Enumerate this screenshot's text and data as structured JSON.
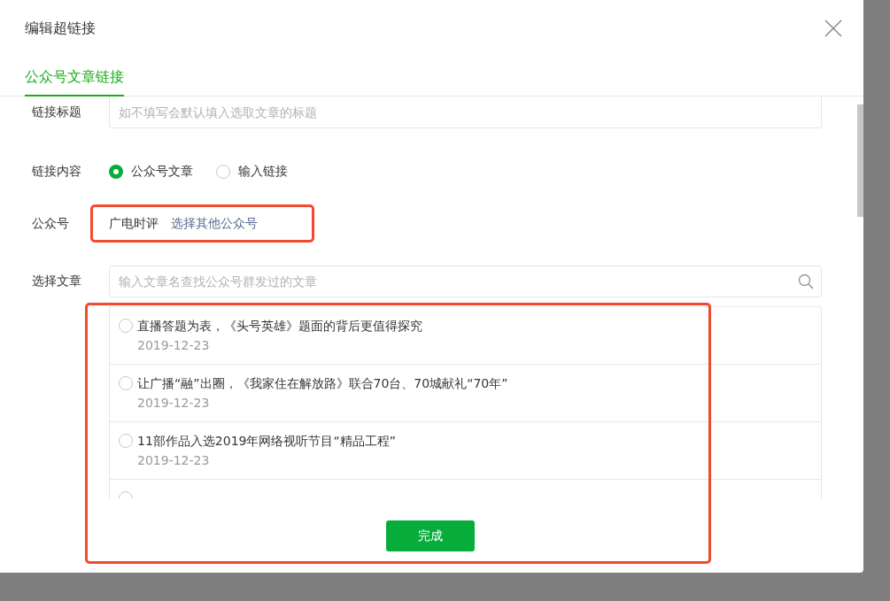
{
  "dialog": {
    "title": "编辑超链接"
  },
  "tabs": [
    {
      "label": "公众号文章链接",
      "selected": true
    }
  ],
  "link_title": {
    "label": "链接标题",
    "placeholder": "如不填写会默认填入选取文章的标题"
  },
  "link_content": {
    "label": "链接内容",
    "options": [
      {
        "label": "公众号文章",
        "selected": true
      },
      {
        "label": "输入链接",
        "selected": false
      }
    ]
  },
  "account": {
    "label": "公众号",
    "name": "广电时评",
    "change_link": "选择其他公众号",
    "highlighted": true
  },
  "article_search": {
    "label": "选择文章",
    "placeholder": "输入文章名查找公众号群发过的文章"
  },
  "articles": [
    {
      "title": "直播答题为表，《头号英雄》题面的背后更值得探究",
      "date": "2019-12-23",
      "selected": false
    },
    {
      "title": "让广播“融”出圈，《我家住在解放路》联合70台、70城献礼“70年”",
      "date": "2019-12-23",
      "selected": false
    },
    {
      "title": "11部作品入选2019年网络视听节目“精品工程”",
      "date": "2019-12-23",
      "selected": false
    },
    {
      "selected": false
    }
  ],
  "articles_highlighted": true,
  "done_button": "完成"
}
